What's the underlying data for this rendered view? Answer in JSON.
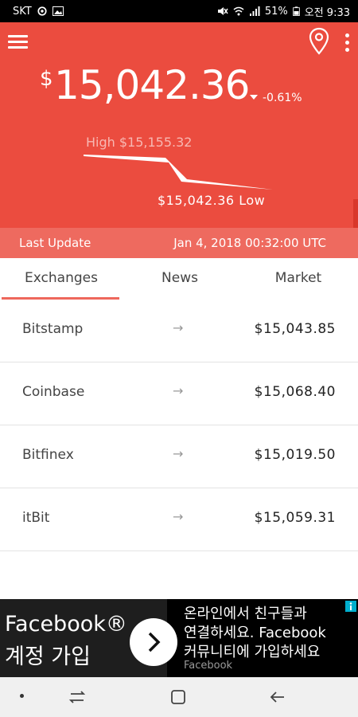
{
  "status_bar": {
    "carrier": "SKT",
    "battery": "51%",
    "time": "오전 9:33"
  },
  "header": {
    "currency_symbol": "$",
    "price": "15,042.36",
    "change": "-0.61%",
    "high_label": "High $15,155.32",
    "low_label": "$15,042.36 Low",
    "last_update_label": "Last Update",
    "last_update_value": "Jan 4, 2018 00:32:00 UTC"
  },
  "tabs": [
    {
      "label": "Exchanges",
      "active": true
    },
    {
      "label": "News",
      "active": false
    },
    {
      "label": "Market",
      "active": false
    }
  ],
  "exchanges": [
    {
      "name": "Bitstamp",
      "arrow": "→",
      "price": "$15,043.85"
    },
    {
      "name": "Coinbase",
      "arrow": "→",
      "price": "$15,068.40"
    },
    {
      "name": "Bitfinex",
      "arrow": "→",
      "price": "$15,019.50"
    },
    {
      "name": "itBit",
      "arrow": "→",
      "price": "$15,059.31"
    }
  ],
  "ad": {
    "title": "Facebook®",
    "subtitle": "계정 가입",
    "line1": "온라인에서 친구들과",
    "line2": "연결하세요. Facebook",
    "line3": "커뮤니티에 가입하세요",
    "brand": "Facebook"
  },
  "colors": {
    "accent": "#eb4c3f",
    "update_bar": "#ee6a5f"
  },
  "icons": {
    "menu": "hamburger-icon",
    "location": "map-pin-icon",
    "more": "vertical-dots-icon"
  }
}
